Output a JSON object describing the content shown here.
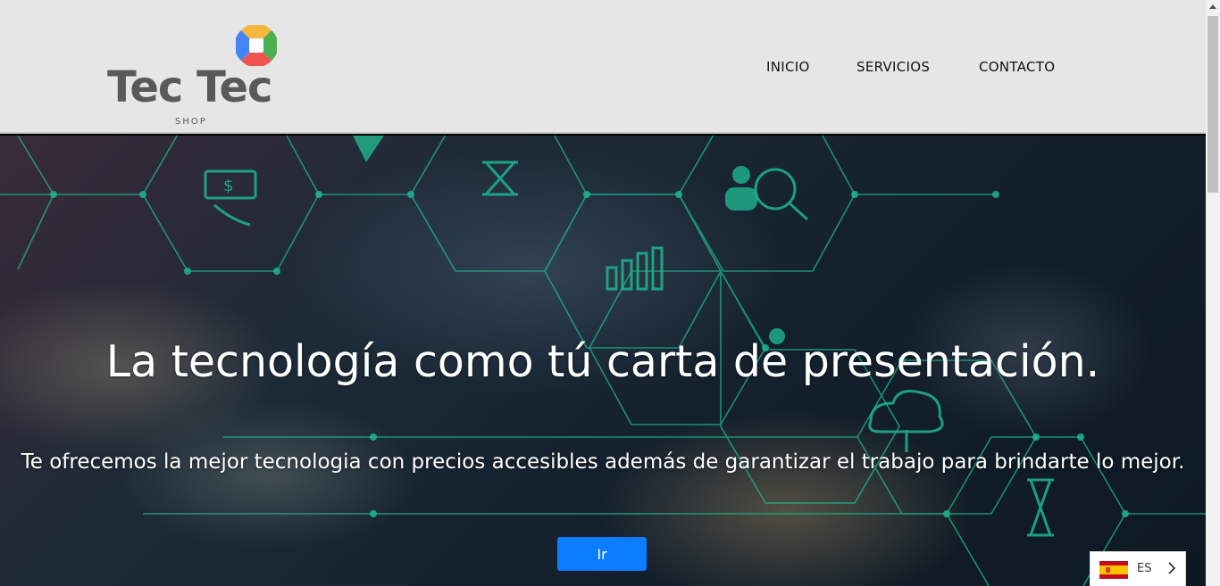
{
  "brand": {
    "name": "Tec Tec",
    "tagline": "SHOP",
    "mark_colors": [
      "#f6b73c",
      "#4caf50",
      "#ef5350",
      "#4285f4"
    ]
  },
  "nav": {
    "items": [
      {
        "label": "INICIO"
      },
      {
        "label": "SERVICIOS"
      },
      {
        "label": "CONTACTO"
      }
    ]
  },
  "hero": {
    "title": "La tecnología como tú carta de presentación.",
    "subtitle": "Te ofrecemos la mejor tecnologia con precios accesibles además de garantizar el trabajo para brindarte lo mejor.",
    "button_label": "Ir",
    "accent_color": "#0b7dff",
    "network_color": "#1fb58f"
  },
  "language": {
    "code": "ES",
    "flag_icon": "spain-flag-icon"
  }
}
